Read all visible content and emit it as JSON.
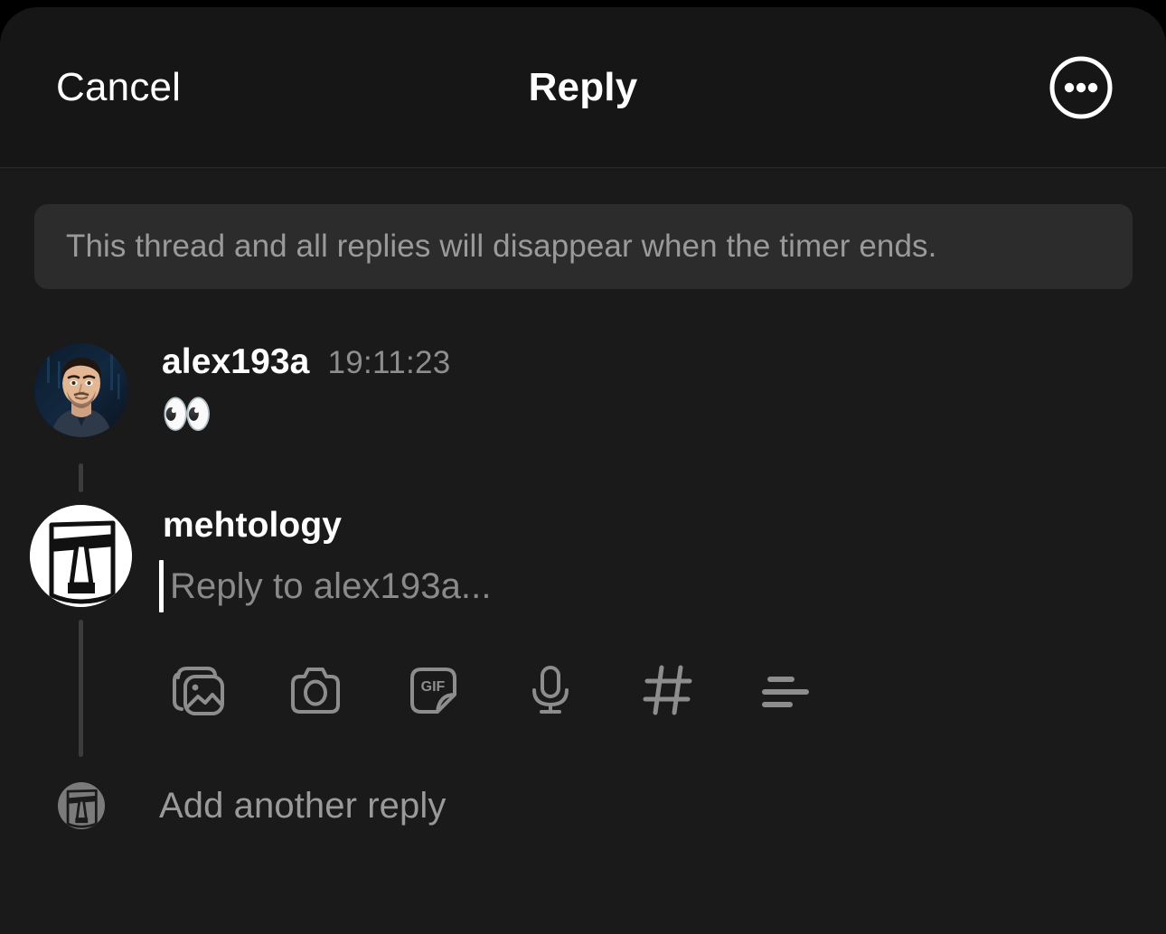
{
  "header": {
    "cancel_label": "Cancel",
    "title": "Reply",
    "more_icon": "more-horizontal-circle-icon"
  },
  "notice": {
    "text": "This thread and all replies will disappear when the timer ends."
  },
  "thread": {
    "messages": [
      {
        "username": "alex193a",
        "timestamp": "19:11:23",
        "body": "👀",
        "avatar_icon": "user-photo-avatar"
      }
    ],
    "composer": {
      "username": "mehtology",
      "placeholder": "Reply to alex193a...",
      "value": "",
      "avatar_icon": "moai-avatar"
    },
    "toolbar": [
      {
        "name": "gallery-icon",
        "label": "Photo library"
      },
      {
        "name": "camera-icon",
        "label": "Camera"
      },
      {
        "name": "gif-icon",
        "label": "GIF"
      },
      {
        "name": "microphone-icon",
        "label": "Voice message"
      },
      {
        "name": "hashtag-icon",
        "label": "Hashtag"
      },
      {
        "name": "format-text-icon",
        "label": "Formatting"
      }
    ],
    "add_another_reply": {
      "label": "Add another reply",
      "avatar_icon": "moai-avatar-small"
    }
  },
  "colors": {
    "background": "#1a1a1a",
    "header_background": "#161616",
    "notice_background": "#2c2c2c",
    "text_primary": "#ffffff",
    "text_secondary": "#8e8e8e",
    "connector": "#3c3c3c"
  }
}
